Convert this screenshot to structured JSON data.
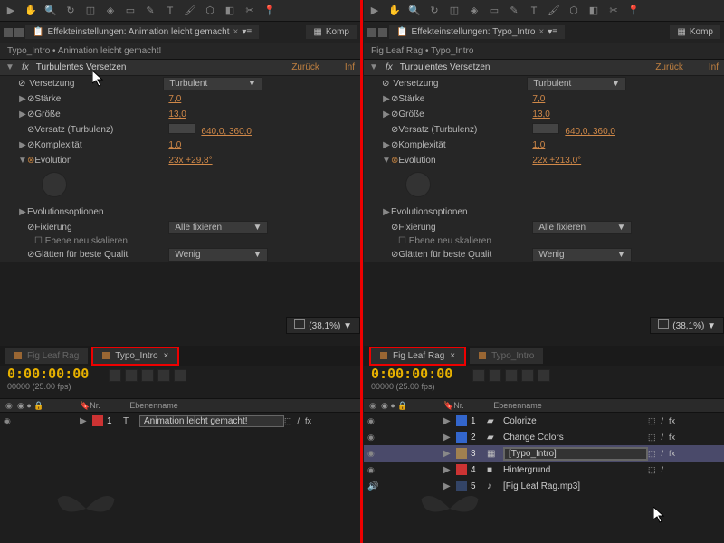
{
  "left": {
    "tabs": {
      "effects": "Effekteinstellungen: Animation leicht gemacht",
      "komp": "Komp"
    },
    "breadcrumb": "Typo_Intro • Animation leicht gemacht!",
    "effect": {
      "name": "Turbulentes Versetzen",
      "reset": "Zurück",
      "info": "Inf"
    },
    "props": {
      "versetzung": {
        "l": "Versetzung",
        "v": "Turbulent"
      },
      "staerke": {
        "l": "Stärke",
        "v": "7,0"
      },
      "groesse": {
        "l": "Größe",
        "v": "13,0"
      },
      "versatz": {
        "l": "Versatz (Turbulenz)",
        "v": "640,0, 360,0"
      },
      "komplex": {
        "l": "Komplexität",
        "v": "1,0"
      },
      "evolution": {
        "l": "Evolution",
        "v": "23x +29,8°"
      },
      "evo_opt": "Evolutionsoptionen",
      "fixierung": {
        "l": "Fixierung",
        "v": "Alle fixieren"
      },
      "ebene_skal": "Ebene neu skalieren",
      "glaetten": {
        "l": "Glätten für beste Qualit",
        "v": "Wenig"
      }
    },
    "zoom": "(38,1%)",
    "tl_tabs": {
      "a": "Fig Leaf Rag",
      "b": "Typo_Intro"
    },
    "timecode": {
      "big": "0:00:00:00",
      "small": "00000 (25.00 fps)"
    },
    "colhdr": {
      "nr": "Nr.",
      "name": "Ebenenname"
    },
    "layer1": {
      "num": "1",
      "name": "Animation leicht gemacht!"
    }
  },
  "right": {
    "tabs": {
      "effects": "Effekteinstellungen: Typo_Intro",
      "komp": "Komp"
    },
    "breadcrumb": "Fig Leaf Rag • Typo_Intro",
    "effect": {
      "name": "Turbulentes Versetzen",
      "reset": "Zurück",
      "info": "Inf"
    },
    "props": {
      "versetzung": {
        "l": "Versetzung",
        "v": "Turbulent"
      },
      "staerke": {
        "l": "Stärke",
        "v": "7,0"
      },
      "groesse": {
        "l": "Größe",
        "v": "13,0"
      },
      "versatz": {
        "l": "Versatz (Turbulenz)",
        "v": "640,0, 360,0"
      },
      "komplex": {
        "l": "Komplexität",
        "v": "1,0"
      },
      "evolution": {
        "l": "Evolution",
        "v": "22x +213,0°"
      },
      "evo_opt": "Evolutionsoptionen",
      "fixierung": {
        "l": "Fixierung",
        "v": "Alle fixieren"
      },
      "ebene_skal": "Ebene neu skalieren",
      "glaetten": {
        "l": "Glätten für beste Qualit",
        "v": "Wenig"
      }
    },
    "zoom": "(38,1%)",
    "tl_tabs": {
      "a": "Fig Leaf Rag",
      "b": "Typo_Intro"
    },
    "timecode": {
      "big": "0:00:00:00",
      "small": "00000 (25.00 fps)"
    },
    "colhdr": {
      "nr": "Nr.",
      "name": "Ebenenname"
    },
    "layers": [
      {
        "num": "1",
        "name": "Colorize",
        "color": "#3366cc"
      },
      {
        "num": "2",
        "name": "Change Colors",
        "color": "#3366cc"
      },
      {
        "num": "3",
        "name": "[Typo_Intro]",
        "color": "#a08050"
      },
      {
        "num": "4",
        "name": "Hintergrund",
        "color": "#cc3333"
      },
      {
        "num": "5",
        "name": "[Fig Leaf Rag.mp3]",
        "color": "#334466"
      }
    ]
  }
}
